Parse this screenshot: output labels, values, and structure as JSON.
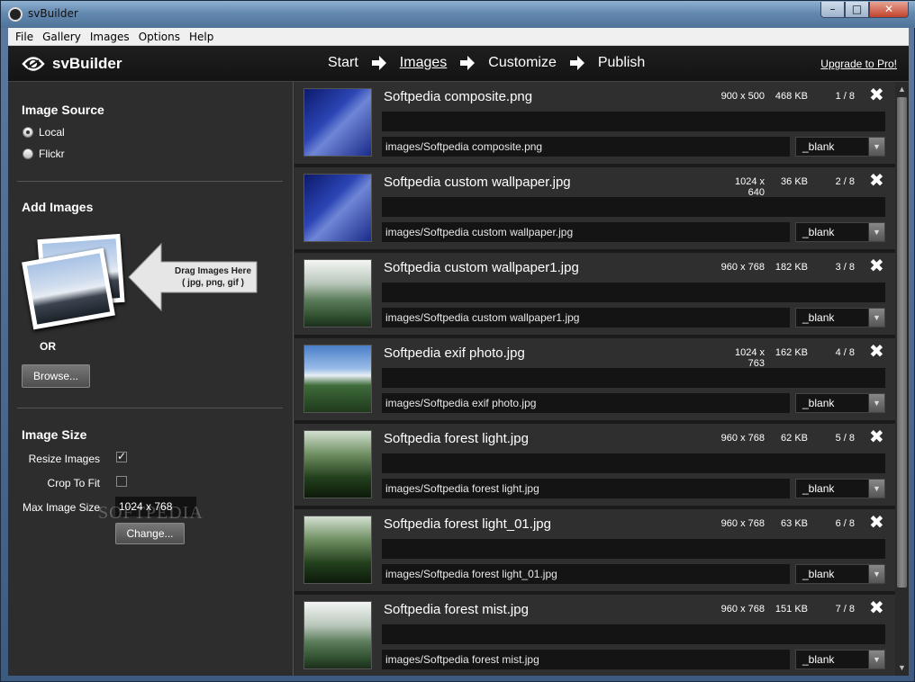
{
  "window": {
    "title": "svBuilder",
    "controls": {
      "minimize": "–",
      "maximize": "□",
      "close": "✕"
    }
  },
  "menu": [
    "File",
    "Gallery",
    "Images",
    "Options",
    "Help"
  ],
  "header": {
    "app_name": "svBuilder",
    "steps": [
      "Start",
      "Images",
      "Customize",
      "Publish"
    ],
    "active_step": "Images",
    "upgrade_label": "Upgrade to Pro!"
  },
  "left": {
    "source_title": "Image Source",
    "sources": [
      {
        "label": "Local",
        "selected": true
      },
      {
        "label": "Flickr",
        "selected": false
      }
    ],
    "add_title": "Add Images",
    "drag_text_line1": "Drag Images Here",
    "drag_text_line2": "( jpg, png, gif )",
    "or_label": "OR",
    "browse_label": "Browse...",
    "size_title": "Image Size",
    "resize_label": "Resize Images",
    "resize_checked": true,
    "crop_label": "Crop To Fit",
    "crop_checked": false,
    "max_size_label": "Max Image Size",
    "max_size_value": "1024 x 768",
    "change_label": "Change...",
    "watermark": "SOFTPEDIA"
  },
  "images": [
    {
      "name": "Softpedia composite.png",
      "dims": "900 x 500",
      "size": "468 KB",
      "count": "1 / 8",
      "path": "images/Softpedia composite.png",
      "target": "_blank",
      "thumb": "blue"
    },
    {
      "name": "Softpedia custom wallpaper.jpg",
      "dims": "1024 x 640",
      "size": "36 KB",
      "count": "2 / 8",
      "path": "images/Softpedia custom wallpaper.jpg",
      "target": "_blank",
      "thumb": "blue"
    },
    {
      "name": "Softpedia custom wallpaper1.jpg",
      "dims": "960 x 768",
      "size": "182 KB",
      "count": "3 / 8",
      "path": "images/Softpedia custom wallpaper1.jpg",
      "target": "_blank",
      "thumb": "forest"
    },
    {
      "name": "Softpedia exif photo.jpg",
      "dims": "1024 x 763",
      "size": "162 KB",
      "count": "4 / 8",
      "path": "images/Softpedia exif photo.jpg",
      "target": "_blank",
      "thumb": "mountain"
    },
    {
      "name": "Softpedia forest light.jpg",
      "dims": "960 x 768",
      "size": "62 KB",
      "count": "5 / 8",
      "path": "images/Softpedia forest light.jpg",
      "target": "_blank",
      "thumb": "dark"
    },
    {
      "name": "Softpedia forest light_01.jpg",
      "dims": "960 x 768",
      "size": "63 KB",
      "count": "6 / 8",
      "path": "images/Softpedia forest light_01.jpg",
      "target": "_blank",
      "thumb": "dark"
    },
    {
      "name": "Softpedia forest mist.jpg",
      "dims": "960 x 768",
      "size": "151 KB",
      "count": "7 / 8",
      "path": "images/Softpedia forest mist.jpg",
      "target": "_blank",
      "thumb": "forest"
    }
  ],
  "row_close_glyph": "✖",
  "dropdown_glyph": "▼",
  "scroll": {
    "up": "▲",
    "down": "▼"
  }
}
